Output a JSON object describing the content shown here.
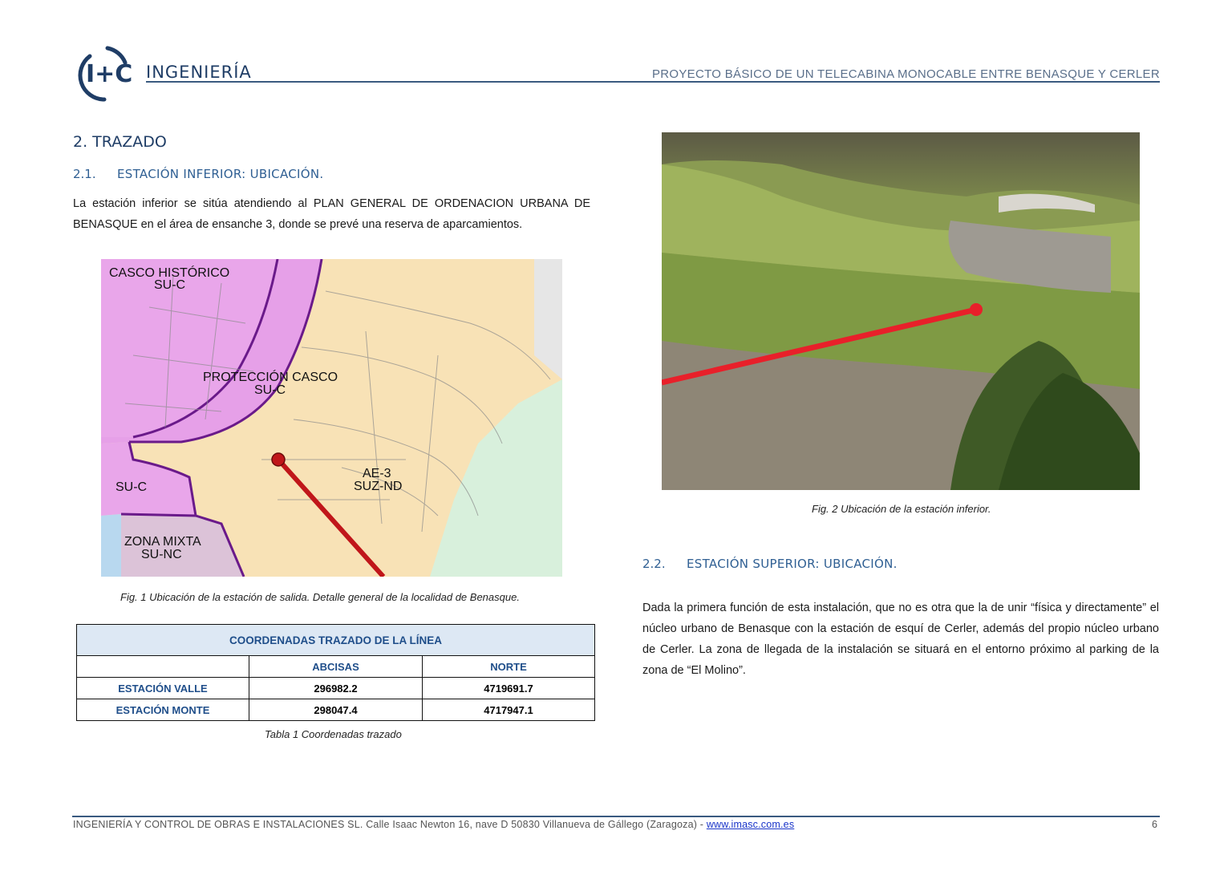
{
  "header": {
    "logo_text": "INGENIERÍA",
    "logo_mark": "I+C",
    "project_title": "PROYECTO BÁSICO DE UN TELECABINA MONOCABLE ENTRE BENASQUE Y CERLER"
  },
  "section": {
    "number_title": "2. TRAZADO"
  },
  "sub1": {
    "number": "2.1.",
    "title": "ESTACIÓN INFERIOR: UBICACIÓN.",
    "paragraph": "La estación inferior se sitúa atendiendo al PLAN GENERAL DE ORDENACION URBANA DE BENASQUE en el área de ensanche 3, donde se prevé una reserva de aparcamientos."
  },
  "figure1": {
    "labels": {
      "casco_1": "CASCO HISTÓRICO",
      "casco_2": "SU-C",
      "prot_1": "PROTECCIÓN CASCO",
      "prot_2": "SU-C",
      "suc": "SU-C",
      "ae_1": "AE-3",
      "ae_2": "SUZ-ND",
      "mixta_1": "ZONA MIXTA",
      "mixta_2": "SU-NC"
    },
    "caption": "Fig. 1 Ubicación de la estación de salida. Detalle general de la localidad de Benasque."
  },
  "table": {
    "title": "COORDENADAS TRAZADO DE LA LÍNEA",
    "col1": "ABCISAS",
    "col2": "NORTE",
    "rows": [
      {
        "label": "ESTACIÓN VALLE",
        "abcisas": "296982.2",
        "norte": "4719691.7"
      },
      {
        "label": "ESTACIÓN MONTE",
        "abcisas": "298047.4",
        "norte": "4717947.1"
      }
    ],
    "caption": "Tabla 1 Coordenadas trazado"
  },
  "figure2": {
    "caption": "Fig. 2 Ubicación de la estación inferior."
  },
  "sub2": {
    "number": "2.2.",
    "title": "ESTACIÓN SUPERIOR: UBICACIÓN.",
    "paragraph": "Dada la primera función de esta instalación, que no es otra que la de unir “física y directamente” el núcleo urbano de Benasque con la estación de esquí de Cerler, además del propio núcleo urbano de Cerler. La zona de llegada de la instalación se situará en el entorno próximo al parking de la zona de “El Molino”."
  },
  "footer": {
    "text": "INGENIERÍA Y CONTROL DE OBRAS E INSTALACIONES SL. Calle Isaac Newton 16, nave D 50830 Villanueva de Gállego (Zaragoza) - ",
    "link": "www.imasc.com.es",
    "page": "6"
  },
  "colors": {
    "brand": "#1f3d66",
    "heading": "#2f5f93",
    "route": "#c0161a"
  }
}
